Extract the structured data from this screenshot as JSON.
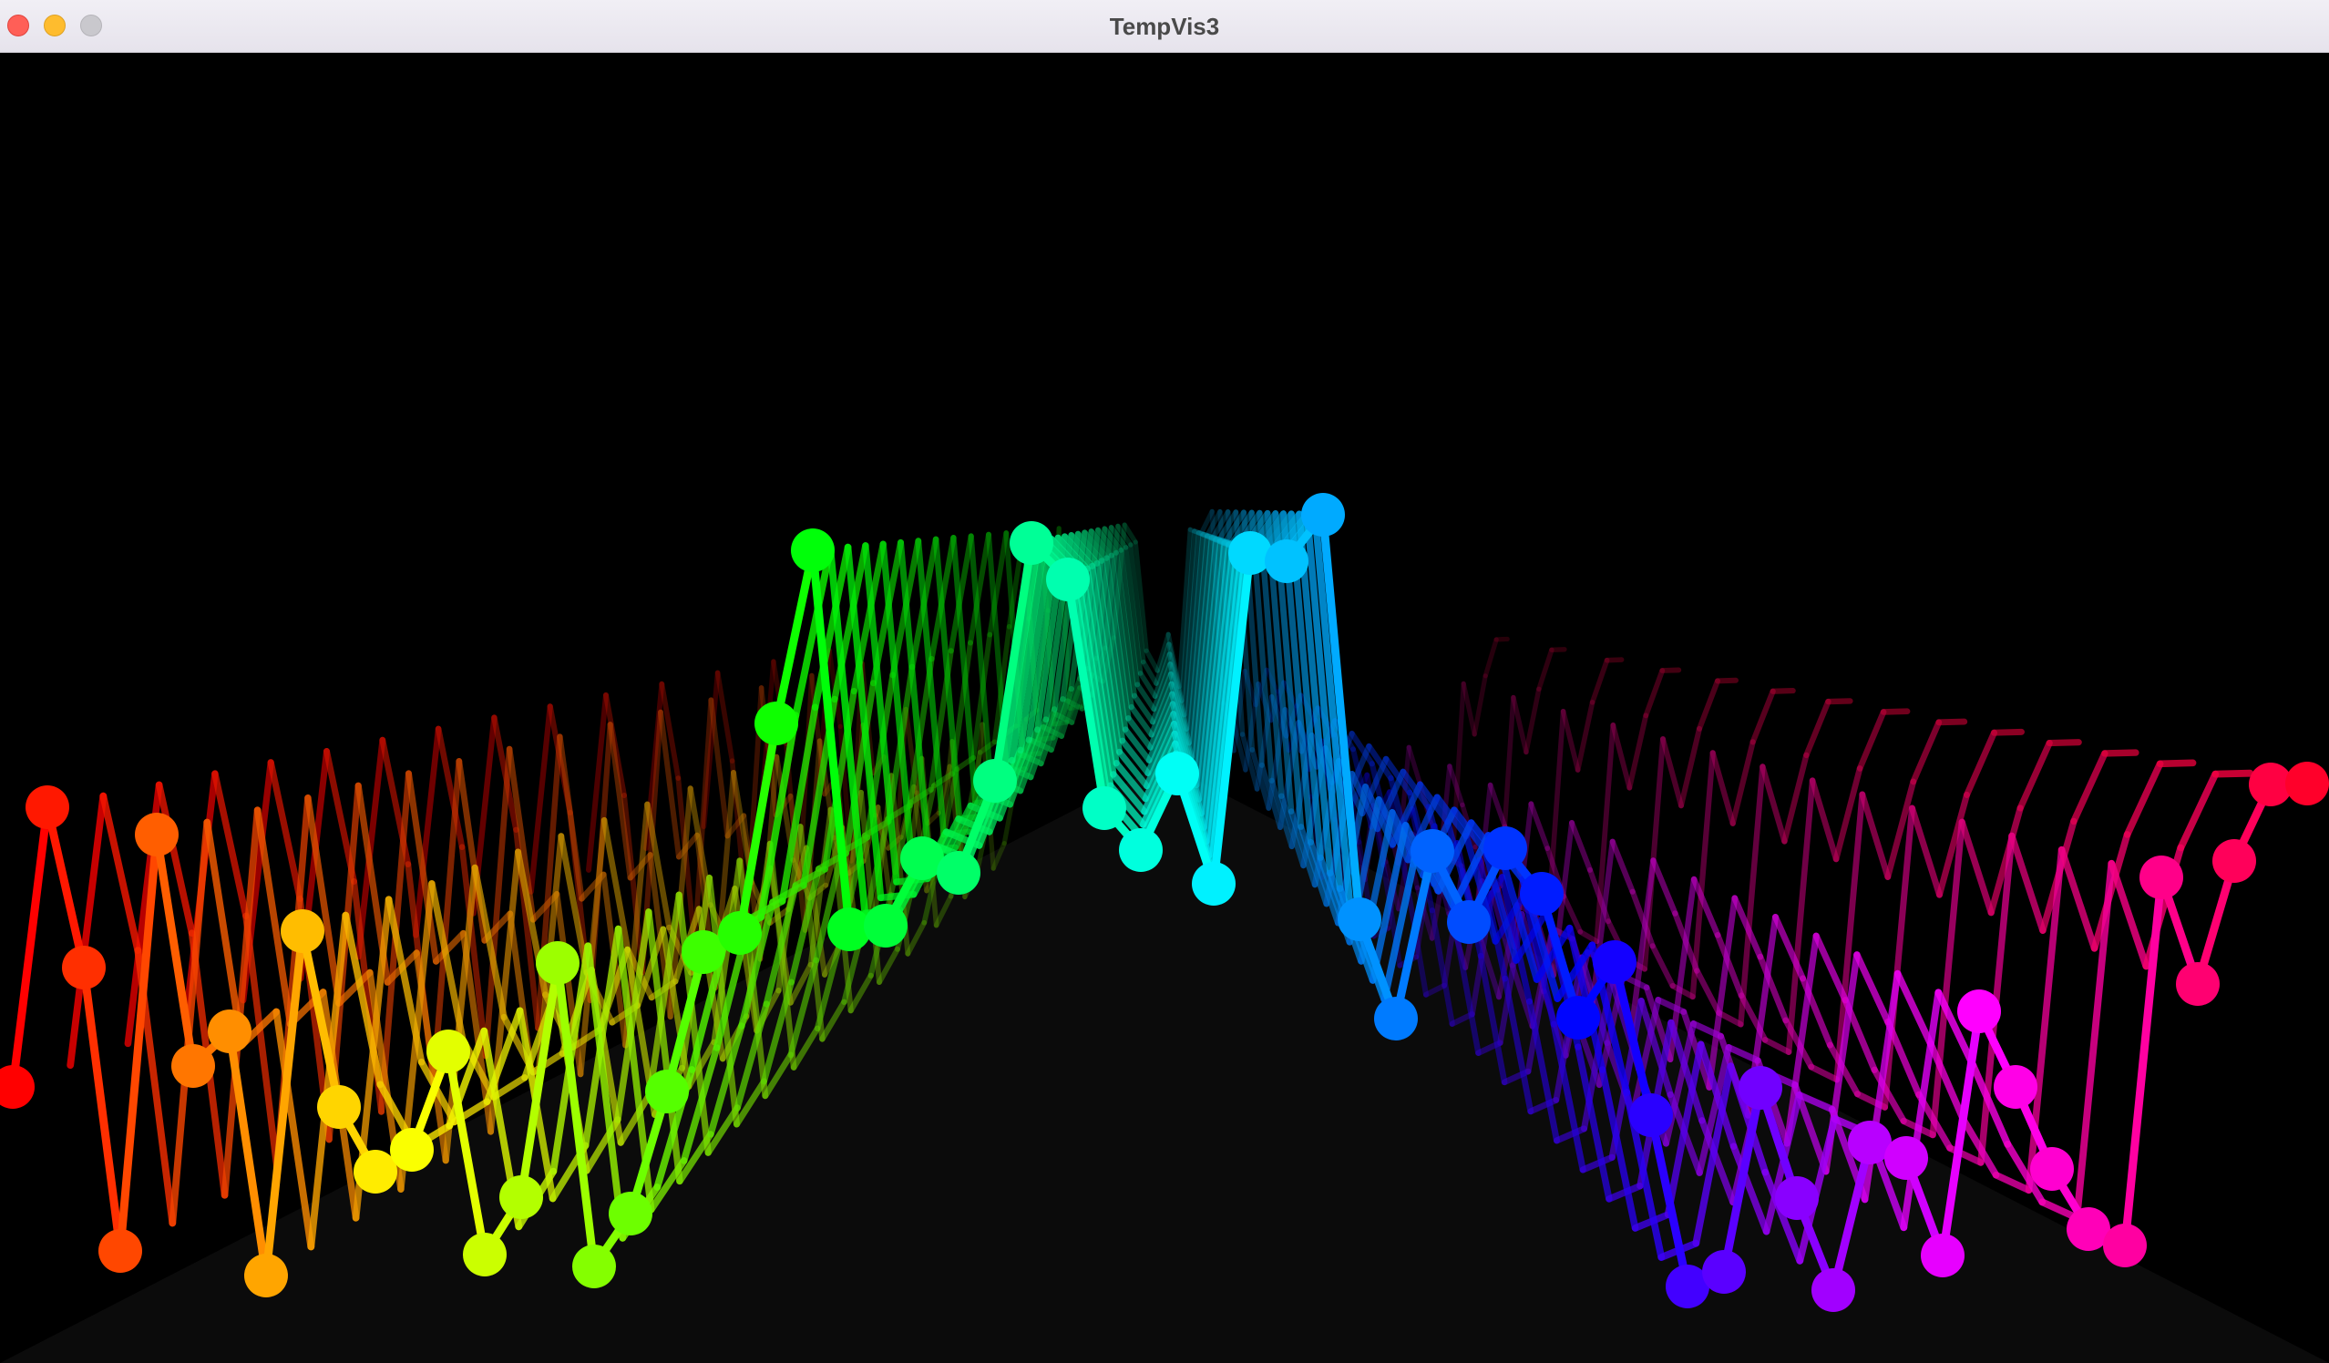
{
  "window": {
    "title": "TempVis3",
    "controls": [
      "close",
      "minimize",
      "zoom"
    ],
    "colors": {
      "close": "#ff5f57",
      "minimize": "#febc2e",
      "zoom": "#c9c8cd",
      "background": "#000000",
      "floor": "#0a0a0a"
    }
  },
  "visualization": {
    "layers": 14,
    "hue_start": 0,
    "hue_end": 350
  }
}
